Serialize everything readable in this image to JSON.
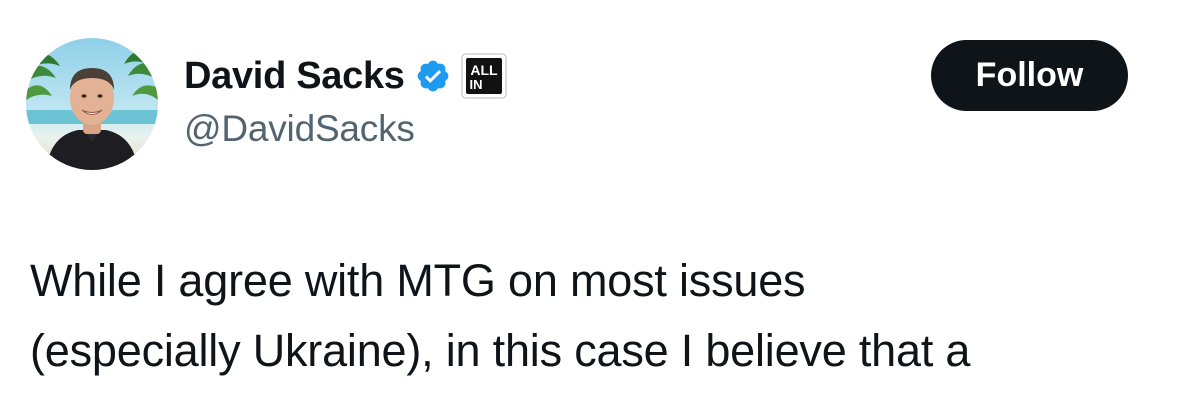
{
  "author": {
    "display_name": "David Sacks",
    "handle": "@DavidSacks",
    "verified_icon": "verified-badge-icon",
    "verified_color": "#1d9bf0",
    "affiliate_badge": {
      "icon": "all-in-podcast-badge-icon",
      "text_line1": "ALL",
      "text_line2": "IN"
    },
    "avatar": "profile-photo"
  },
  "follow_button": {
    "label": "Follow",
    "background": "#0f1419",
    "text_color": "#ffffff"
  },
  "tweet": {
    "lines": [
      "While I agree with MTG on most issues",
      "(especially Ukraine), in this case I believe that a"
    ]
  },
  "colors": {
    "text_primary": "#0f1419",
    "text_secondary": "#536471"
  }
}
